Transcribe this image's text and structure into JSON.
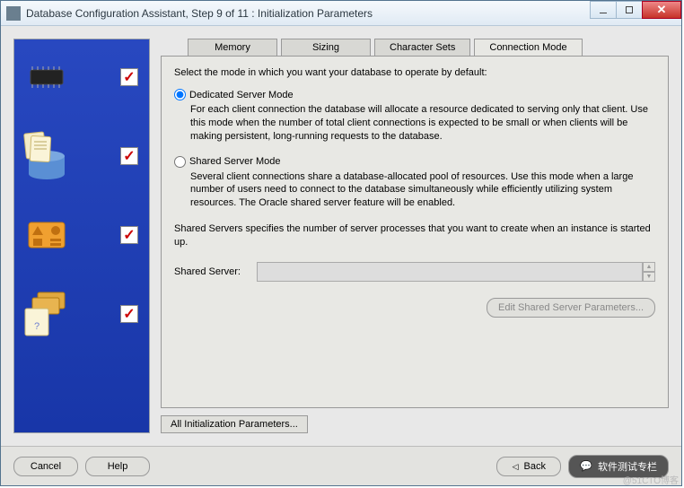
{
  "window": {
    "title": "Database Configuration Assistant, Step 9 of 11 : Initialization Parameters"
  },
  "tabs": {
    "memory": "Memory",
    "sizing": "Sizing",
    "character_sets": "Character Sets",
    "connection_mode": "Connection Mode"
  },
  "intro": "Select the mode in which you want your database to operate by default:",
  "dedicated": {
    "label": "Dedicated Server Mode",
    "desc": "For each client connection the database will allocate a resource dedicated to serving only that client.  Use this mode when the number of total client connections is expected to be small or when clients will be making persistent, long-running requests to the database."
  },
  "shared": {
    "label": "Shared Server Mode",
    "desc": "Several client connections share a database-allocated pool of resources.  Use this mode when a large number of users need to connect to the database simultaneously while efficiently utilizing system resources.  The Oracle shared server feature will be enabled."
  },
  "shared_note": "Shared Servers specifies the number of server processes that you want to create when an instance is started up.",
  "shared_server_label": "Shared Server:",
  "shared_server_value": "",
  "edit_params_btn": "Edit Shared Server Parameters...",
  "all_params_btn": "All Initialization Parameters...",
  "footer": {
    "cancel": "Cancel",
    "help": "Help",
    "back": "Back",
    "next_label": "软件测试专栏"
  },
  "watermark": "@51CTO博客"
}
